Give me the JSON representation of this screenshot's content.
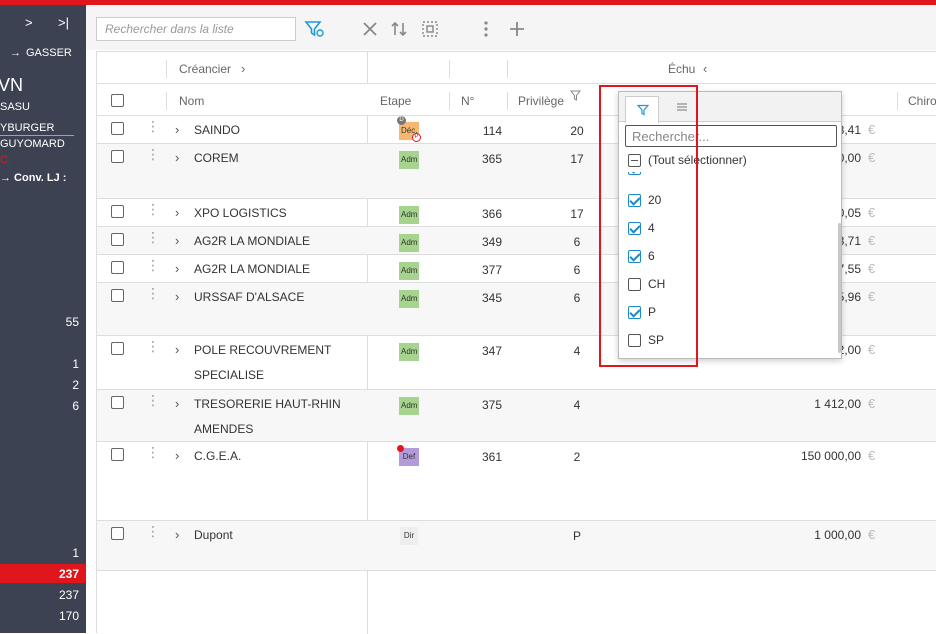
{
  "sidebar": {
    "nav_next": ">",
    "nav_last": ">|",
    "arrow_gasser": "→",
    "gasser": "GASSER",
    "big_text": "VN",
    "sasu": "SASU",
    "yburger": "YBURGER",
    "guyomard": "GUYOMARD",
    "cc": "C.",
    "conv_lj": "→ Conv. LJ :",
    "counts": [
      "55",
      "1",
      "2",
      "6",
      "1",
      "237",
      "237",
      "170"
    ]
  },
  "toolbar": {
    "search_placeholder": "Rechercher dans la liste"
  },
  "grid": {
    "group_creancier": "Créancier",
    "group_echu": "Échu",
    "col_nom": "Nom",
    "col_etape": "Etape",
    "col_num": "N°",
    "col_privilege": "Privilège",
    "col_chiro": "Chiro",
    "rows": [
      {
        "nom": "SAINDO",
        "nom2": "",
        "etape": "Déc.",
        "num": "114",
        "priv": "20",
        "amt": "8,41"
      },
      {
        "nom": "COREM",
        "nom2": "",
        "etape": "Adm",
        "num": "365",
        "priv": "17",
        "amt": "0,00"
      },
      {
        "nom": "XPO LOGISTICS",
        "nom2": "",
        "etape": "Adm",
        "num": "366",
        "priv": "17",
        "amt": "0,05"
      },
      {
        "nom": "AG2R LA MONDIALE",
        "nom2": "",
        "etape": "Adm",
        "num": "349",
        "priv": "6",
        "amt": "3,71"
      },
      {
        "nom": "AG2R LA MONDIALE",
        "nom2": "",
        "etape": "Adm",
        "num": "377",
        "priv": "6",
        "amt": "7,55"
      },
      {
        "nom": "URSSAF D'ALSACE",
        "nom2": "",
        "etape": "Adm",
        "num": "345",
        "priv": "6",
        "amt": "5,96"
      },
      {
        "nom": "POLE RECOUVREMENT",
        "nom2": "SPECIALISE",
        "etape": "Adm",
        "num": "347",
        "priv": "4",
        "amt": "2,00"
      },
      {
        "nom": "TRESORERIE HAUT-RHIN",
        "nom2": "AMENDES",
        "etape": "Adm",
        "num": "375",
        "priv": "4",
        "amt": "1 412,00"
      },
      {
        "nom": "C.G.E.A.",
        "nom2": "",
        "etape": "Def",
        "num": "361",
        "priv": "2",
        "amt": "150 000,00"
      },
      {
        "nom": "Dupont",
        "nom2": "",
        "etape": "Dir",
        "num": "",
        "priv": "P",
        "amt": "1 000,00"
      }
    ],
    "currency": "€",
    "badge_d": "D",
    "badge_p": "P"
  },
  "filter_dropdown": {
    "search_placeholder": "Rechercher...",
    "select_all": "(Tout sélectionner)",
    "options": [
      "–",
      "20",
      "4",
      "6",
      "CH",
      "P",
      "SP"
    ],
    "checked": [
      true,
      true,
      true,
      true,
      false,
      true,
      false
    ]
  }
}
